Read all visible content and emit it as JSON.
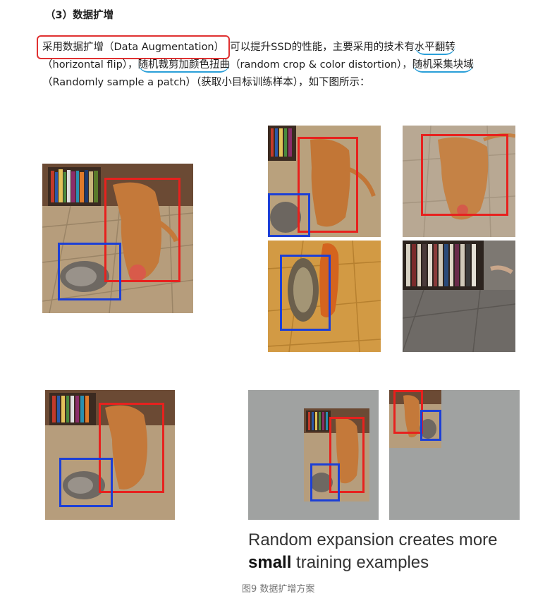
{
  "section": {
    "heading": "（3）数据扩增"
  },
  "paragraph": {
    "line1_boxed": "采用数据扩增（Data Augmentation）",
    "line1_rest": "可以提升SSD的性能，主要采用的技术有",
    "line1_tech1": "水平翻转",
    "line2_tech1_en": "（horizontal flip），",
    "line2_tech2": "随机裁剪加颜色扭曲",
    "line2_tech2_en": "（random crop & color distortion），",
    "line2_tech3": "随机采集块域",
    "line3_tech3_en": "（Randomly sample a patch）",
    "line3_rest": "（获取小目标训练样本），如下图所示："
  },
  "figure": {
    "expansion_caption_line1": "Random expansion creates more",
    "expansion_caption_bold": "small",
    "expansion_caption_rest": " training examples",
    "caption": "图9 数据扩增方案"
  },
  "colors": {
    "red_box": "#e7211e",
    "blue_box": "#1c3fd6",
    "underline_blue": "#2a9fd8",
    "canvas_gray": "#a0a2a1"
  }
}
